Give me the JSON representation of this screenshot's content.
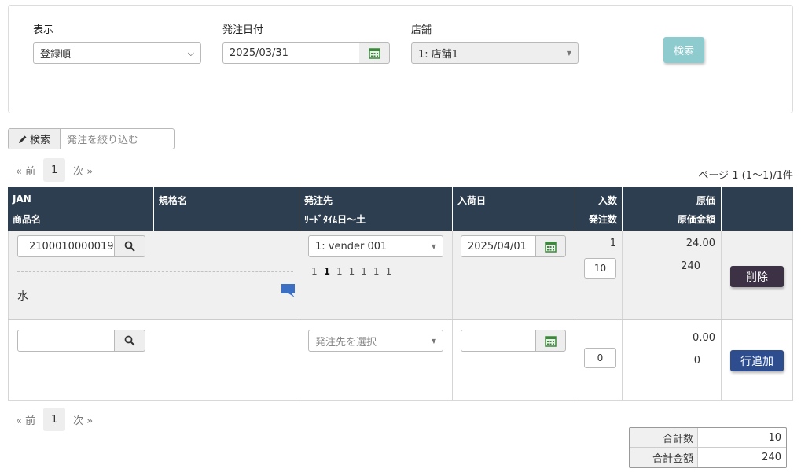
{
  "search_panel": {
    "display_label": "表示",
    "display_value": "登録順",
    "date_label": "発注日付",
    "date_value": "2025/03/31",
    "store_label": "店舗",
    "store_value": "1: 店舗1",
    "search_button": "検索"
  },
  "filter": {
    "button_label": "検索",
    "placeholder": "発注を絞り込む"
  },
  "pager": {
    "prev": "« 前",
    "current": "1",
    "next": "次 »",
    "page_info": "ページ 1 (1〜1)/1件"
  },
  "table": {
    "headers": {
      "jan": "JAN",
      "product_name": "商品名",
      "spec_name": "規格名",
      "supplier": "発注先",
      "lead_time": "ﾘｰﾄﾞﾀｲﾑ日〜土",
      "arrival_date": "入荷日",
      "pack_qty": "入数",
      "order_qty": "発注数",
      "cost": "原価",
      "cost_amount": "原価金額"
    },
    "rows": [
      {
        "jan": "2100010000019",
        "product_name": "水",
        "supplier": "1: vender 001",
        "lead_time_days": [
          "1",
          "1",
          "1",
          "1",
          "1",
          "1",
          "1"
        ],
        "arrival_date": "2025/04/01",
        "pack_qty": "1",
        "order_qty": "10",
        "cost": "24.00",
        "cost_amount": "240",
        "action": "削除"
      },
      {
        "jan": "",
        "supplier_placeholder": "発注先を選択",
        "arrival_date": "",
        "order_qty": "0",
        "cost": "0.00",
        "cost_amount": "0",
        "action": "行追加"
      }
    ]
  },
  "totals": {
    "total_qty_label": "合計数",
    "total_qty": "10",
    "total_amount_label": "合計金額",
    "total_amount": "240"
  },
  "colors": {
    "header_bg": "#2c3e50",
    "search_button": "#8ecbcf",
    "delete_button": "#3d3245",
    "add_button": "#2e4d8f",
    "calendar_icon": "#3a8a3a",
    "comment_icon": "#3b6fc4"
  }
}
